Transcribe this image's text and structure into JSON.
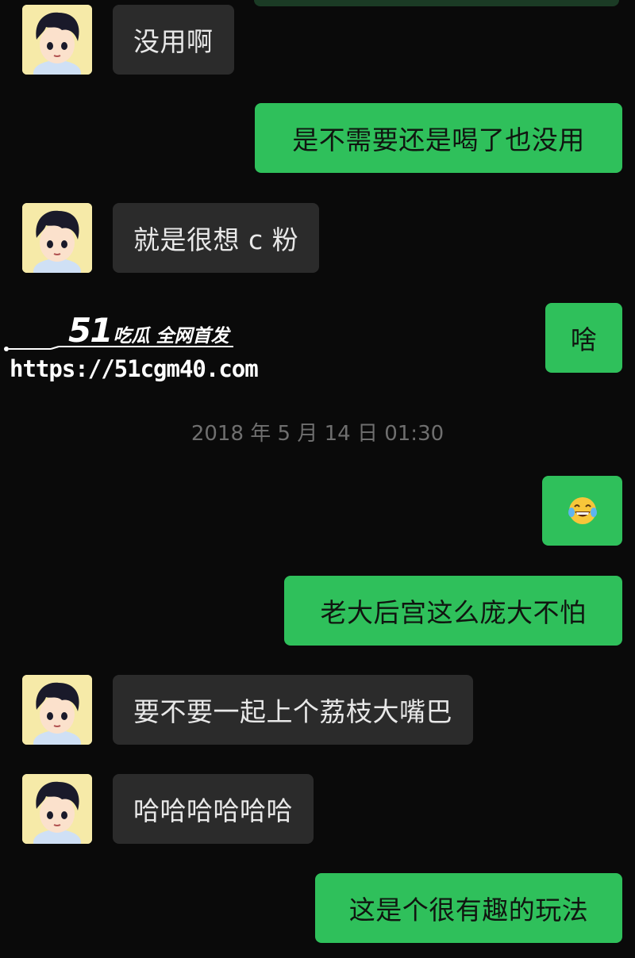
{
  "conversation": {
    "messages": [
      {
        "side": "in",
        "text": "没用啊"
      },
      {
        "side": "out",
        "text": "是不需要还是喝了也没用"
      },
      {
        "side": "in",
        "text": "就是很想 c 粉"
      },
      {
        "side": "out",
        "text": "啥"
      },
      {
        "side": "out",
        "emoji": "laughing-tears-emoji"
      },
      {
        "side": "out",
        "text": "老大后宫这么庞大不怕"
      },
      {
        "side": "in",
        "text": "要不要一起上个荔枝大嘴巴"
      },
      {
        "side": "in",
        "text": "哈哈哈哈哈哈"
      },
      {
        "side": "out",
        "text": "这是个很有趣的玩法"
      }
    ],
    "timestamp": "2018 年 5 月 14 日 01:30"
  },
  "watermark": {
    "brand_number": "51",
    "brand_text": "吃瓜 全网首发",
    "url": "https://51cgm40.com"
  },
  "colors": {
    "background": "#0a0a0a",
    "incoming_bubble": "#2b2b2b",
    "outgoing_bubble": "#2fc05b",
    "avatar_bg": "#f6eaa8"
  }
}
